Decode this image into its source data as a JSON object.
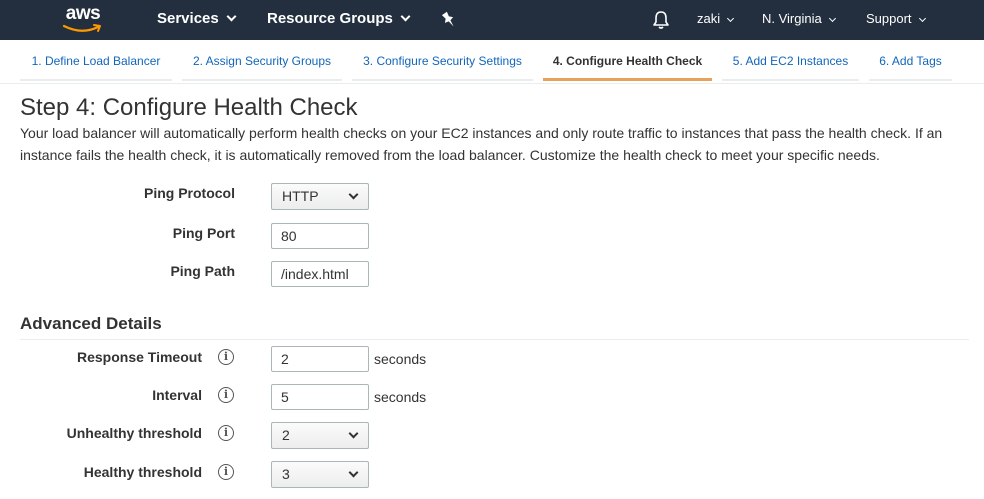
{
  "header": {
    "logo_text": "aws",
    "services": "Services",
    "resource_groups": "Resource Groups",
    "user": "zaki",
    "region": "N. Virginia",
    "support": "Support"
  },
  "wizard": {
    "steps": [
      {
        "label": "1. Define Load Balancer"
      },
      {
        "label": "2. Assign Security Groups"
      },
      {
        "label": "3. Configure Security Settings"
      },
      {
        "label": "4. Configure Health Check"
      },
      {
        "label": "5. Add EC2 Instances"
      },
      {
        "label": "6. Add Tags"
      }
    ],
    "active_index": 3
  },
  "page": {
    "title": "Step 4: Configure Health Check",
    "description": "Your load balancer will automatically perform health checks on your EC2 instances and only route traffic to instances that pass the health check. If an instance fails the health check, it is automatically removed from the load balancer. Customize the health check to meet your specific needs."
  },
  "health_check": {
    "ping_protocol_label": "Ping Protocol",
    "ping_protocol_value": "HTTP",
    "ping_port_label": "Ping Port",
    "ping_port_value": "80",
    "ping_path_label": "Ping Path",
    "ping_path_value": "/index.html"
  },
  "advanced": {
    "title": "Advanced Details",
    "info_glyph": "i",
    "response_timeout_label": "Response Timeout",
    "response_timeout_value": "2",
    "response_timeout_unit": "seconds",
    "interval_label": "Interval",
    "interval_value": "5",
    "interval_unit": "seconds",
    "unhealthy_label": "Unhealthy threshold",
    "unhealthy_value": "2",
    "healthy_label": "Healthy threshold",
    "healthy_value": "3"
  },
  "colors": {
    "topbar": "#232f3e",
    "link": "#1166bb",
    "active_step_underline": "#e7a15b",
    "logo_smile": "#ff9900"
  },
  "icons": [
    "chevron-down-icon",
    "pin-icon",
    "bell-icon",
    "info-icon",
    "aws-smile-icon"
  ]
}
